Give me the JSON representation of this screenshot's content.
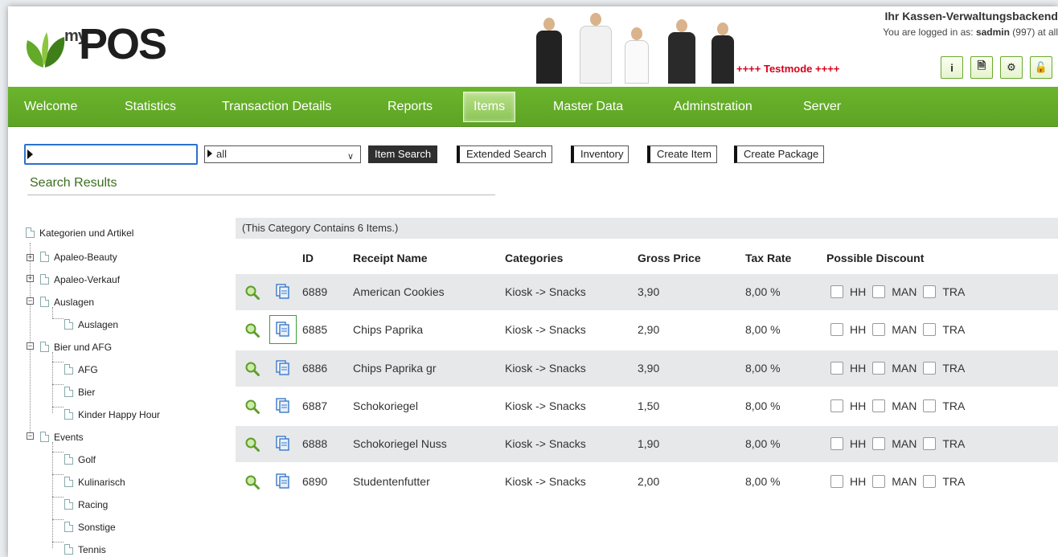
{
  "header": {
    "logo_my": "my",
    "logo_pos": "POS",
    "testmode": "++++ Testmode ++++",
    "backend_title": "Ihr Kassen-Verwaltungsbackend",
    "logged_in_prefix": "You are logged in as:",
    "user": "sadmin",
    "user_suffix": "(997) at all",
    "buttons": [
      {
        "icon": "info-icon",
        "glyph": "i"
      },
      {
        "icon": "document-icon",
        "glyph": "🗎"
      },
      {
        "icon": "gears-icon",
        "glyph": "⚙"
      },
      {
        "icon": "unlock-icon",
        "glyph": "🔓"
      }
    ]
  },
  "nav": {
    "items": [
      "Welcome",
      "Statistics",
      "Transaction Details",
      "Reports",
      "Items",
      "Master Data",
      "Adminstration",
      "Server"
    ],
    "active": "Items"
  },
  "toolbar": {
    "search_value": "",
    "category_select": "all",
    "item_search": "Item Search",
    "extended_search": "Extended Search",
    "inventory": "Inventory",
    "create_item": "Create Item",
    "create_package": "Create Package"
  },
  "results_title": "Search Results",
  "tree": {
    "root": "Kategorien und Artikel",
    "nodes": [
      {
        "label": "Apaleo-Beauty",
        "state": "collapsed"
      },
      {
        "label": "Apaleo-Verkauf",
        "state": "collapsed"
      },
      {
        "label": "Auslagen",
        "state": "expanded",
        "children": [
          "Auslagen"
        ]
      },
      {
        "label": "Bier und AFG",
        "state": "expanded",
        "children": [
          "AFG",
          "Bier",
          "Kinder Happy Hour"
        ]
      },
      {
        "label": "Events",
        "state": "expanded",
        "children": [
          "Golf",
          "Kulinarisch",
          "Racing",
          "Sonstige",
          "Tennis"
        ]
      }
    ]
  },
  "table": {
    "info": "(This Category Contains 6 Items.)",
    "headers": [
      "ID",
      "Receipt Name",
      "Categories",
      "Gross Price",
      "Tax Rate",
      "Possible Discount"
    ],
    "discount_labels": [
      "HH",
      "MAN",
      "TRA"
    ],
    "rows": [
      {
        "id": "6889",
        "name": "American Cookies",
        "category": "Kiosk -> Snacks",
        "price": "3,90",
        "tax": "8,00 %"
      },
      {
        "id": "6885",
        "name": "Chips Paprika",
        "category": "Kiosk -> Snacks",
        "price": "2,90",
        "tax": "8,00 %"
      },
      {
        "id": "6886",
        "name": "Chips Paprika gr",
        "category": "Kiosk -> Snacks",
        "price": "3,90",
        "tax": "8,00 %"
      },
      {
        "id": "6887",
        "name": "Schokoriegel",
        "category": "Kiosk -> Snacks",
        "price": "1,50",
        "tax": "8,00 %"
      },
      {
        "id": "6888",
        "name": "Schokoriegel Nuss",
        "category": "Kiosk -> Snacks",
        "price": "1,90",
        "tax": "8,00 %"
      },
      {
        "id": "6890",
        "name": "Studentenfutter",
        "category": "Kiosk -> Snacks",
        "price": "2,00",
        "tax": "8,00 %"
      }
    ]
  },
  "colors": {
    "nav_green": "#62aa27",
    "testmode_red": "#d6001c",
    "title_green": "#3c6e1e",
    "row_shade": "#e6e8ea",
    "focus_blue": "#2a73c9"
  }
}
